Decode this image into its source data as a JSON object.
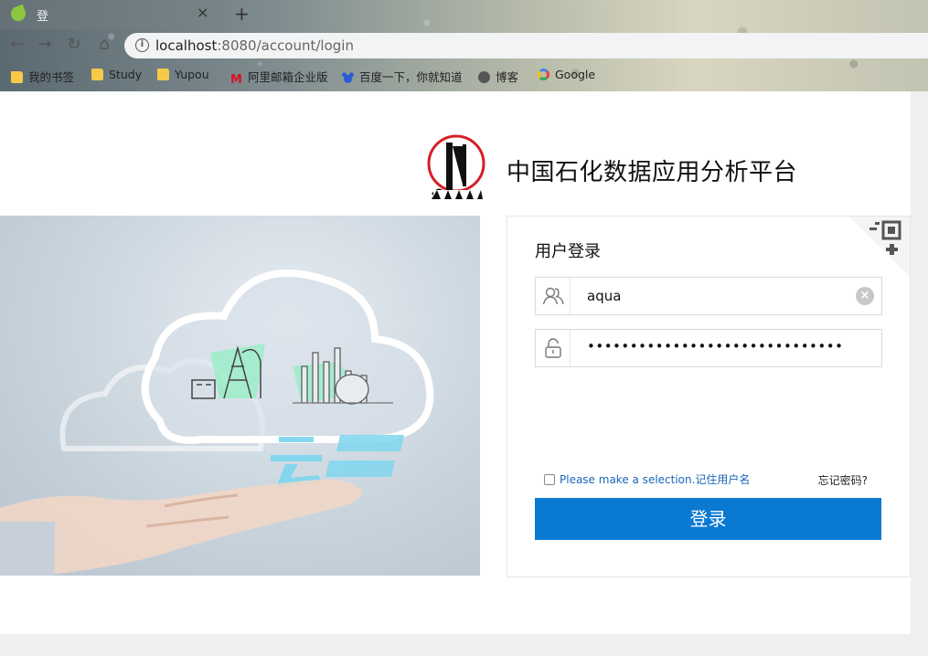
{
  "browser": {
    "tab_title": "登",
    "tab_close": "×",
    "new_tab": "+",
    "back": "←",
    "forward": "→",
    "reload": "↻",
    "home": "⌂",
    "info": "i",
    "url_host": "localhost",
    "url_path": ":8080/account/login",
    "bookmarks": [
      {
        "label": "我的书签",
        "icon": "folder-icon"
      },
      {
        "label": "Study",
        "icon": "folder-icon"
      },
      {
        "label": "Yupou",
        "icon": "folder-icon"
      },
      {
        "label": "阿里邮箱企业版",
        "icon": "mail-icon"
      },
      {
        "label": "百度一下，你就知道",
        "icon": "baidu-icon"
      },
      {
        "label": "博客",
        "icon": "blog-icon"
      },
      {
        "label": "Google",
        "icon": "google-icon"
      }
    ]
  },
  "header": {
    "site_title": "中国石化数据应用分析平台"
  },
  "login": {
    "title": "用户登录",
    "username_value": "aqua",
    "password_masked": "••••••••••••••••••••••••••••••",
    "clear": "×",
    "remember_label": "Please make a selection.记住用户名",
    "forgot_label": "忘记密码?",
    "submit_label": "登录"
  },
  "colors": {
    "primary_button": "#0a79d1",
    "link": "#1a65b8"
  }
}
